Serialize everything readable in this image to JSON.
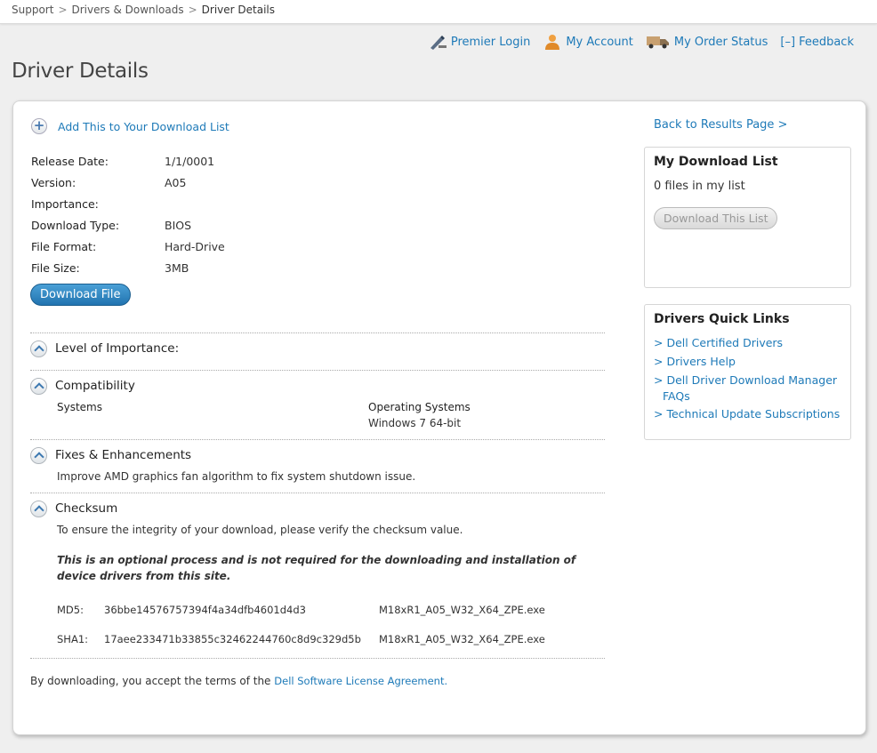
{
  "breadcrumb": [
    "Support",
    "Drivers & Downloads",
    "Driver Details"
  ],
  "utility": {
    "premier_login": "Premier Login",
    "my_account": "My Account",
    "order_status": "My Order Status",
    "feedback_icon": "[–]",
    "feedback": "Feedback"
  },
  "page_title": "Driver Details",
  "add_to_list": "Add This to Your Download List",
  "details": {
    "release_date_label": "Release Date:",
    "release_date": "1/1/0001",
    "version_label": "Version:",
    "version": "A05",
    "importance_label": "Importance:",
    "importance": "",
    "download_type_label": "Download Type:",
    "download_type": "BIOS",
    "file_format_label": "File Format:",
    "file_format": "Hard-Drive",
    "file_size_label": "File Size:",
    "file_size": "3MB"
  },
  "download_file": "Download File",
  "sections": {
    "importance": "Level of Importance:",
    "compatibility": "Compatibility",
    "systems_header": "Systems",
    "os_header": "Operating Systems",
    "os_value": "Windows 7 64-bit",
    "fixes": "Fixes & Enhancements",
    "fixes_text": "Improve AMD graphics fan algorithm to fix system shutdown issue.",
    "checksum": "Checksum",
    "checksum_intro": "To ensure the integrity of your download, please verify the checksum value.",
    "checksum_note": "This is an optional process and is not required for the downloading and installation of device drivers from this site.",
    "md5_label": "MD5:",
    "md5_value": "36bbe14576757394f4a34dfb4601d4d3",
    "md5_file": "M18xR1_A05_W32_X64_ZPE.exe",
    "sha1_label": "SHA1:",
    "sha1_value": "17aee233471b33855c32462244760c8d9c329d5b",
    "sha1_file": "M18xR1_A05_W32_X64_ZPE.exe"
  },
  "terms": {
    "text": "By downloading, you accept the terms of the ",
    "link": "Dell Software License Agreement."
  },
  "sidebar": {
    "back_link": "Back to Results Page >",
    "download_list_title": "My Download List",
    "files_count": "0 files in my list",
    "download_this_list": "Download This List",
    "quick_links_title": "Drivers Quick Links",
    "quick_links": [
      "> Dell Certified Drivers",
      "> Drivers Help",
      "> Dell Driver Download Manager",
      "FAQs",
      "> Technical Update Subscriptions"
    ]
  },
  "colors": {
    "link": "#1e7ab8",
    "button_blue": "#2173b0",
    "background": "#efefef"
  },
  "icons": [
    "pen-icon",
    "person-icon",
    "truck-icon",
    "plus-icon",
    "chevron-up-icon"
  ]
}
